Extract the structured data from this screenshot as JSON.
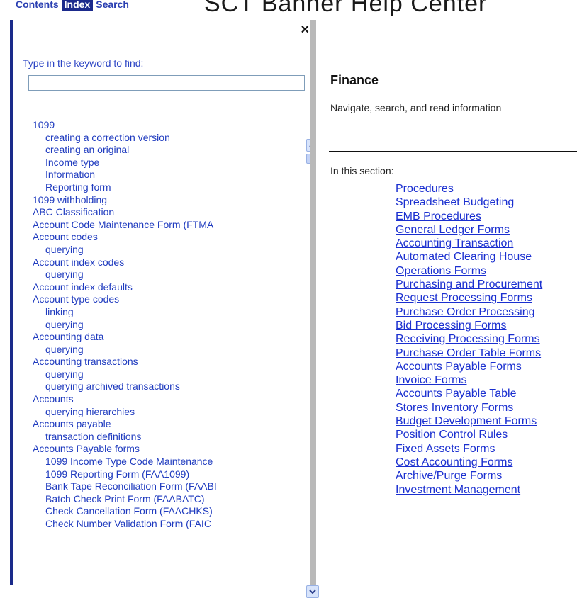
{
  "header": {
    "tabs": [
      "Contents",
      "Index",
      "Search"
    ],
    "active_tab": "Index",
    "title": "SCT Banner Help Center"
  },
  "index_pane": {
    "close_glyph": "×",
    "prompt": "Type in the keyword to find:",
    "keyword_value": "",
    "entries": [
      {
        "text": "1099",
        "level": 1
      },
      {
        "text": "creating a correction version",
        "level": 2
      },
      {
        "text": "creating an original",
        "level": 2
      },
      {
        "text": "Income type",
        "level": 2
      },
      {
        "text": "Information",
        "level": 2
      },
      {
        "text": "Reporting form",
        "level": 2
      },
      {
        "text": "1099 withholding",
        "level": 1
      },
      {
        "text": "ABC Classification",
        "level": 1
      },
      {
        "text": "Account Code Maintenance Form (FTMA",
        "level": 1
      },
      {
        "text": "Account codes",
        "level": 1
      },
      {
        "text": "querying",
        "level": 2
      },
      {
        "text": "Account index codes",
        "level": 1
      },
      {
        "text": "querying",
        "level": 2
      },
      {
        "text": "Account index defaults",
        "level": 1
      },
      {
        "text": "Account type codes",
        "level": 1
      },
      {
        "text": "linking",
        "level": 2
      },
      {
        "text": "querying",
        "level": 2
      },
      {
        "text": "Accounting data",
        "level": 1
      },
      {
        "text": "querying",
        "level": 2
      },
      {
        "text": "Accounting transactions",
        "level": 1
      },
      {
        "text": "querying",
        "level": 2
      },
      {
        "text": "querying archived transactions",
        "level": 2
      },
      {
        "text": "Accounts",
        "level": 1
      },
      {
        "text": "querying hierarchies",
        "level": 2
      },
      {
        "text": "Accounts payable",
        "level": 1
      },
      {
        "text": "transaction definitions",
        "level": 2
      },
      {
        "text": "Accounts Payable forms",
        "level": 1
      },
      {
        "text": "1099 Income Type Code Maintenance",
        "level": 2
      },
      {
        "text": "1099 Reporting Form (FAA1099)",
        "level": 2
      },
      {
        "text": "Bank Tape Reconciliation Form (FAABI",
        "level": 2
      },
      {
        "text": "Batch Check Print Form (FAABATC)",
        "level": 2
      },
      {
        "text": "Check Cancellation Form (FAACHKS)",
        "level": 2
      },
      {
        "text": "Check Number Validation Form (FAIC",
        "level": 2
      }
    ]
  },
  "content_pane": {
    "heading": "Finance",
    "description": "Navigate, search, and read information",
    "section_label": "In this section:",
    "links": [
      {
        "text": "Procedures",
        "underline": true
      },
      {
        "text": "Spreadsheet Budgeting",
        "underline": false
      },
      {
        "text": "EMB Procedures",
        "underline": true
      },
      {
        "text": "General Ledger Forms",
        "underline": true
      },
      {
        "text": "Accounting Transaction",
        "underline": true
      },
      {
        "text": "Automated Clearing House",
        "underline": true
      },
      {
        "text": "Operations Forms",
        "underline": true
      },
      {
        "text": "Purchasing and Procurement",
        "underline": true
      },
      {
        "text": "Request Processing Forms",
        "underline": true
      },
      {
        "text": "Purchase Order Processing",
        "underline": true
      },
      {
        "text": "Bid Processing Forms",
        "underline": true
      },
      {
        "text": "Receiving Processing Forms",
        "underline": true
      },
      {
        "text": "Purchase Order Table Forms",
        "underline": true
      },
      {
        "text": "Accounts Payable Forms",
        "underline": true
      },
      {
        "text": "Invoice Forms",
        "underline": true
      },
      {
        "text": "Accounts Payable Table",
        "underline": false
      },
      {
        "text": "Stores Inventory Forms",
        "underline": true
      },
      {
        "text": "Budget Development Forms",
        "underline": true
      },
      {
        "text": "Position Control Rules",
        "underline": false
      },
      {
        "text": "Fixed Assets Forms",
        "underline": true
      },
      {
        "text": "Cost Accounting Forms",
        "underline": true
      },
      {
        "text": "Archive/Purge Forms",
        "underline": false
      },
      {
        "text": "Investment Management",
        "underline": true
      }
    ]
  },
  "colors": {
    "active_tab_bg": "#1b2a8c",
    "link": "#1a2fd0",
    "index_text": "#1f3bbf",
    "scrollbar": "#d8e4fb"
  }
}
